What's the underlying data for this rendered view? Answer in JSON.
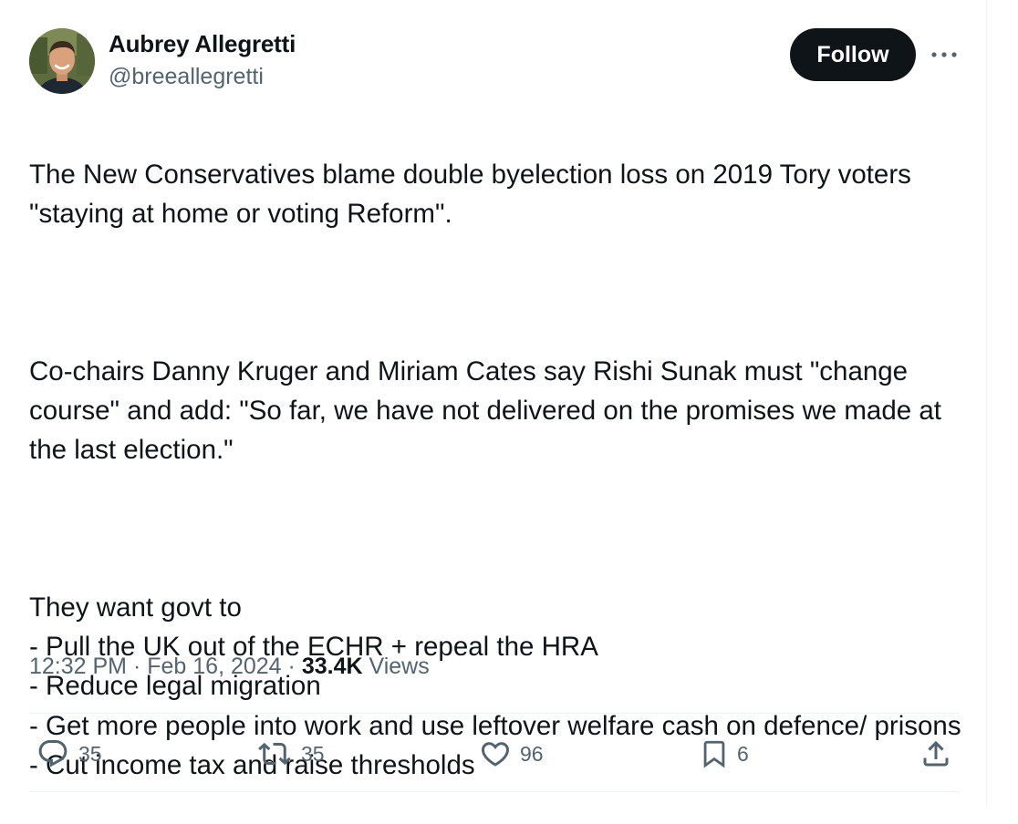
{
  "author": {
    "display_name": "Aubrey Allegretti",
    "handle": "@breeallegretti"
  },
  "header": {
    "follow_label": "Follow",
    "more_icon": "more-horizontal-icon"
  },
  "tweet": {
    "paragraphs": [
      "The New Conservatives blame double byelection loss on 2019 Tory voters \"staying at home or voting Reform\".",
      "Co-chairs Danny Kruger and Miriam Cates say Rishi Sunak must \"change course\" and add: \"So far, we have not delivered on the promises we made at the last election.\"",
      "They want govt to\n- Pull the UK out of the ECHR + repeal the HRA\n- Reduce legal migration\n- Get more people into work and use leftover welfare cash on defence/ prisons\n- Cut income tax and raise thresholds"
    ]
  },
  "meta": {
    "time": "12:32 PM",
    "separator": "·",
    "date": "Feb 16, 2024",
    "views_count": "33.4K",
    "views_label": "Views"
  },
  "actions": {
    "replies": {
      "icon": "reply-icon",
      "count": "35"
    },
    "reposts": {
      "icon": "repost-icon",
      "count": "35"
    },
    "likes": {
      "icon": "like-icon",
      "count": "96"
    },
    "bookmarks": {
      "icon": "bookmark-icon",
      "count": "6"
    },
    "share": {
      "icon": "share-icon"
    }
  }
}
